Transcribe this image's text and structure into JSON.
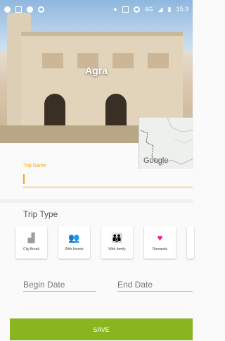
{
  "status_bar": {
    "time": "15:3",
    "network": "4G"
  },
  "hero": {
    "city": "Agra"
  },
  "map": {
    "attribution": "Google"
  },
  "trip_name": {
    "label": "Trip Name",
    "value": ""
  },
  "trip_type": {
    "title": "Trip Type",
    "options": [
      {
        "label": "City Break",
        "icon": "city-icon",
        "icon_color": "#9e9e9e"
      },
      {
        "label": "With friends",
        "icon": "friends-icon",
        "icon_color": "#1e88e5"
      },
      {
        "label": "With family",
        "icon": "family-icon",
        "icon_color": "#f5a623"
      },
      {
        "label": "Romantic",
        "icon": "heart-icon",
        "icon_color": "#e91e8c"
      }
    ]
  },
  "dates": {
    "begin_placeholder": "Begin Date",
    "end_placeholder": "End Date"
  },
  "actions": {
    "save_label": "SAVE"
  },
  "colors": {
    "accent": "#f5a623",
    "save_bar": "#8ab51e"
  }
}
